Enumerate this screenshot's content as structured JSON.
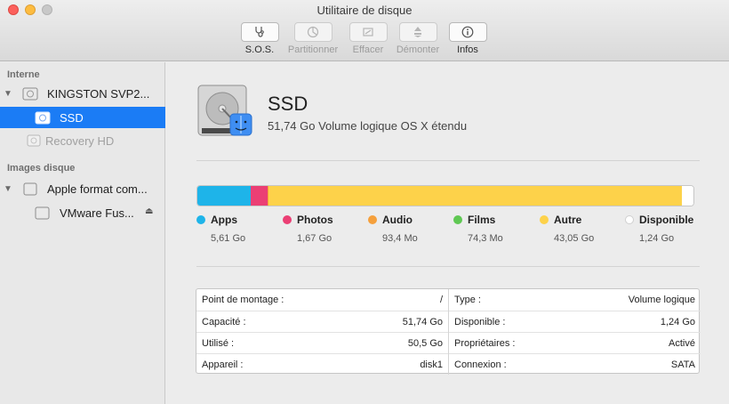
{
  "window": {
    "title": "Utilitaire de disque"
  },
  "toolbar": {
    "items": [
      {
        "label": "S.O.S.",
        "icon": "stethoscope-icon",
        "enabled": true
      },
      {
        "label": "Partitionner",
        "icon": "partition-icon",
        "enabled": false
      },
      {
        "label": "Effacer",
        "icon": "erase-icon",
        "enabled": false
      },
      {
        "label": "Démonter",
        "icon": "unmount-icon",
        "enabled": false
      },
      {
        "label": "Infos",
        "icon": "info-icon",
        "enabled": true
      }
    ]
  },
  "sidebar": {
    "section_internal": "Interne",
    "section_images": "Images disque",
    "items": [
      {
        "label": "KINGSTON SVP2...",
        "icon": "internal-disk-icon"
      },
      {
        "label": "SSD",
        "icon": "volume-icon"
      },
      {
        "label": "Recovery HD",
        "icon": "volume-icon"
      },
      {
        "label": "Apple format com...",
        "icon": "disk-image-icon"
      },
      {
        "label": "VMware Fus...",
        "icon": "volume-icon"
      }
    ]
  },
  "volume": {
    "name": "SSD",
    "description": "51,74 Go Volume logique OS X étendu"
  },
  "usage": {
    "categories": [
      {
        "label": "Apps",
        "value": "5,61 Go",
        "color": "#1eb4e9",
        "fraction": 0.1084
      },
      {
        "label": "Photos",
        "value": "1,67 Go",
        "color": "#eb3f74",
        "fraction": 0.0323
      },
      {
        "label": "Audio",
        "value": "93,4 Mo",
        "color": "#f5a03c",
        "fraction": 0.0018
      },
      {
        "label": "Films",
        "value": "74,3 Mo",
        "color": "#5fc853",
        "fraction": 0.0014
      },
      {
        "label": "Autre",
        "value": "43,05 Go",
        "color": "#fdd24a",
        "fraction": 0.8321
      },
      {
        "label": "Disponible",
        "value": "1,24 Go",
        "color": "#ffffff",
        "fraction": 0.024
      }
    ]
  },
  "info": {
    "left": [
      {
        "key": "Point de montage :",
        "value": "/"
      },
      {
        "key": "Capacité :",
        "value": "51,74 Go"
      },
      {
        "key": "Utilisé :",
        "value": "50,5 Go"
      },
      {
        "key": "Appareil :",
        "value": "disk1"
      }
    ],
    "right": [
      {
        "key": "Type :",
        "value": "Volume logique"
      },
      {
        "key": "Disponible :",
        "value": "1,24 Go"
      },
      {
        "key": "Propriétaires :",
        "value": "Activé"
      },
      {
        "key": "Connexion :",
        "value": "SATA"
      }
    ]
  }
}
